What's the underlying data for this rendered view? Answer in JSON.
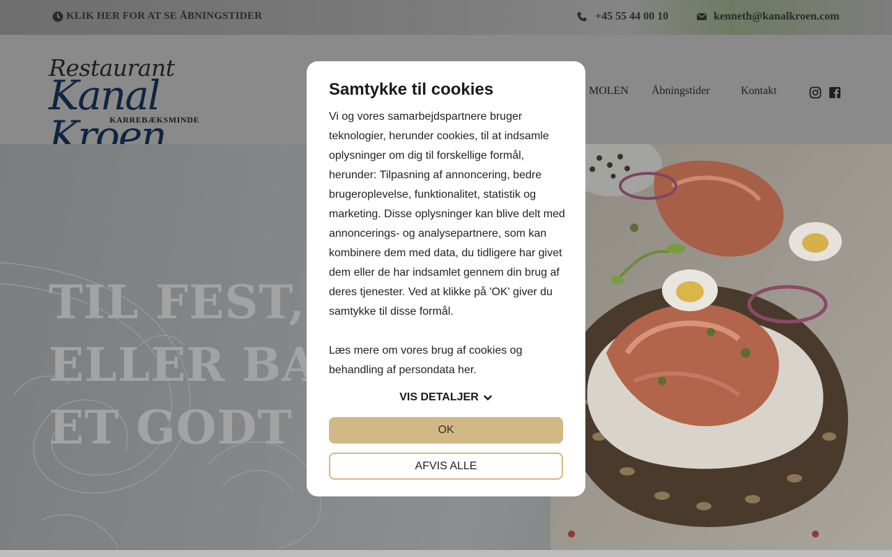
{
  "topbar": {
    "hours_link": "KLIK HER FOR AT SE ÅBNINGSTIDER",
    "phone": "+45 55 44 00 10",
    "email": "kenneth@kanalkroen.com",
    "icons": [
      "clock-icon",
      "phone-icon",
      "envelope-icon"
    ]
  },
  "header": {
    "logo": {
      "line1": "Restaurant",
      "line2": "Kanal Kroen",
      "line3": "KARREBÆKSMINDE"
    },
    "nav": [
      "MOLEN",
      "Åbningstider",
      "Kontakt"
    ],
    "social_icons": [
      "instagram-icon",
      "facebook-icon"
    ]
  },
  "hero": {
    "line1": "TIL FEST,",
    "line2": "ELLER BARE",
    "line3": "ET GODT MÅ"
  },
  "cookie_modal": {
    "title": "Samtykke til cookies",
    "paragraph1": "Vi og vores samarbejdspartnere bruger teknologier, herunder cookies, til at indsamle oplysninger om dig til forskellige formål, herunder: Tilpasning af annoncering, bedre brugeroplevelse, funktionalitet, statistik og marketing. Disse oplysninger kan blive delt med annoncerings- og analysepartnere, som kan kombinere dem med data, du tidligere har givet dem eller de har indsamlet gennem din brug af deres tjenester. Ved at klikke på 'OK' giver du samtykke til disse formål.",
    "paragraph2": "Læs mere om vores brug af cookies og behandling af persondata her.",
    "details_label": "VIS DETALJER",
    "ok_label": "OK",
    "reject_label": "AFVIS ALLE"
  },
  "colors": {
    "accent_gold": "#d2b884",
    "logo_blue": "#0e2540"
  }
}
